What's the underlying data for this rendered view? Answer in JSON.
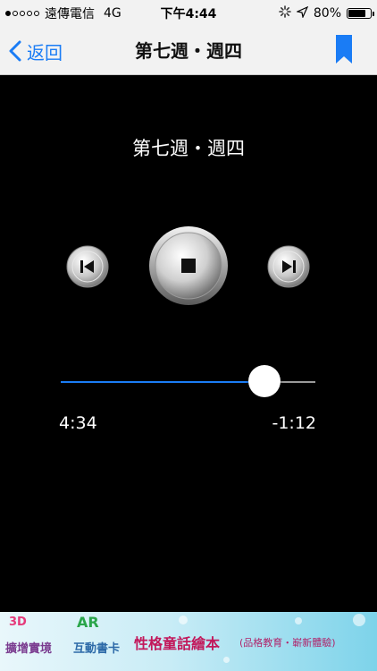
{
  "status_bar": {
    "carrier": "遠傳電信",
    "network": "4G",
    "time": "下午4:44",
    "battery": "80%",
    "battery_level": 0.8
  },
  "nav": {
    "back_label": "返回",
    "title": "第七週・週四"
  },
  "player": {
    "track_title": "第七週・週四",
    "elapsed": "4:34",
    "remaining": "-1:12",
    "progress": 0.8
  },
  "ad": {
    "badge_3d": "3D",
    "line1": "擴增實境",
    "badge_ar": "AR",
    "line2": "互動書卡",
    "headline": "性格童話繪本",
    "subline": "(品格教育・嶄新體驗)"
  },
  "colors": {
    "accent": "#1a7cf5",
    "background": "#000000",
    "bar": "#f2f2f2"
  }
}
